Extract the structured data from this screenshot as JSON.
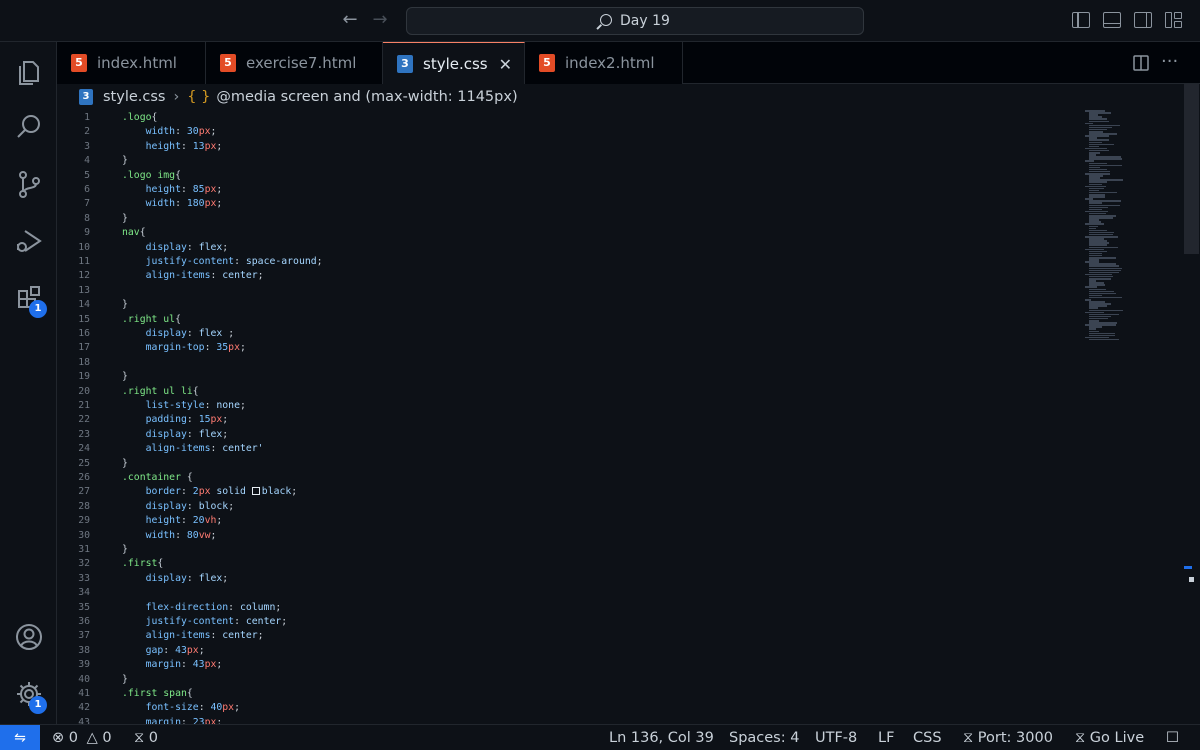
{
  "window": {
    "search_text": "Day 19"
  },
  "tabs": [
    {
      "label": "index.html",
      "type": "html",
      "active": false
    },
    {
      "label": "exercise7.html",
      "type": "html",
      "active": false
    },
    {
      "label": "style.css",
      "type": "css",
      "active": true
    },
    {
      "label": "index2.html",
      "type": "html",
      "active": false
    }
  ],
  "file_icons": {
    "html": "5",
    "css": "3"
  },
  "breadcrumb": {
    "file": "style.css",
    "symbol": "@media screen and (max-width: 1145px)"
  },
  "activity": {
    "extensions_badge": "1",
    "settings_badge": "1"
  },
  "code_lines": [
    {
      "n": "1",
      "text": ".logo{"
    },
    {
      "n": "2",
      "text": "    width: 30px;"
    },
    {
      "n": "3",
      "text": "    height: 13px;"
    },
    {
      "n": "4",
      "text": "}"
    },
    {
      "n": "5",
      "text": ".logo img{"
    },
    {
      "n": "6",
      "text": "    height: 85px;"
    },
    {
      "n": "7",
      "text": "    width: 180px;"
    },
    {
      "n": "8",
      "text": "}"
    },
    {
      "n": "9",
      "text": "nav{"
    },
    {
      "n": "10",
      "text": "    display: flex;"
    },
    {
      "n": "11",
      "text": "    justify-content: space-around;"
    },
    {
      "n": "12",
      "text": "    align-items: center;"
    },
    {
      "n": "13",
      "text": ""
    },
    {
      "n": "14",
      "text": "}"
    },
    {
      "n": "15",
      "text": ".right ul{"
    },
    {
      "n": "16",
      "text": "    display: flex ;"
    },
    {
      "n": "17",
      "text": "    margin-top: 35px;"
    },
    {
      "n": "18",
      "text": ""
    },
    {
      "n": "19",
      "text": "}"
    },
    {
      "n": "20",
      "text": ".right ul li{"
    },
    {
      "n": "21",
      "text": "    list-style: none;"
    },
    {
      "n": "22",
      "text": "    padding: 15px;"
    },
    {
      "n": "23",
      "text": "    display: flex;"
    },
    {
      "n": "24",
      "text": "    align-items: center'"
    },
    {
      "n": "25",
      "text": "}"
    },
    {
      "n": "26",
      "text": ".container {"
    },
    {
      "n": "27",
      "text": "    border: 2px solid black;"
    },
    {
      "n": "28",
      "text": "    display: block;"
    },
    {
      "n": "29",
      "text": "    height: 20vh;"
    },
    {
      "n": "30",
      "text": "    width: 80vw;"
    },
    {
      "n": "31",
      "text": "}"
    },
    {
      "n": "32",
      "text": ".first{"
    },
    {
      "n": "33",
      "text": "    display: flex;"
    },
    {
      "n": "34",
      "text": ""
    },
    {
      "n": "35",
      "text": "    flex-direction: column;"
    },
    {
      "n": "36",
      "text": "    justify-content: center;"
    },
    {
      "n": "37",
      "text": "    align-items: center;"
    },
    {
      "n": "38",
      "text": "    gap: 43px;"
    },
    {
      "n": "39",
      "text": "    margin: 43px;"
    },
    {
      "n": "40",
      "text": "}"
    },
    {
      "n": "41",
      "text": ".first span{"
    },
    {
      "n": "42",
      "text": "    font-size: 40px;"
    },
    {
      "n": "43",
      "text": "    margin: 23px;"
    }
  ],
  "status": {
    "errors": "0",
    "warnings": "0",
    "ports": "0",
    "position": "Ln 136, Col 39",
    "spaces": "Spaces: 4",
    "encoding": "UTF-8",
    "eol": "LF",
    "language": "CSS",
    "port": "Port: 3000",
    "go_live": "Go Live"
  },
  "colors": {
    "background": "#0d1117",
    "accent": "#1f6feb",
    "active_tab_border": "#f78166"
  }
}
